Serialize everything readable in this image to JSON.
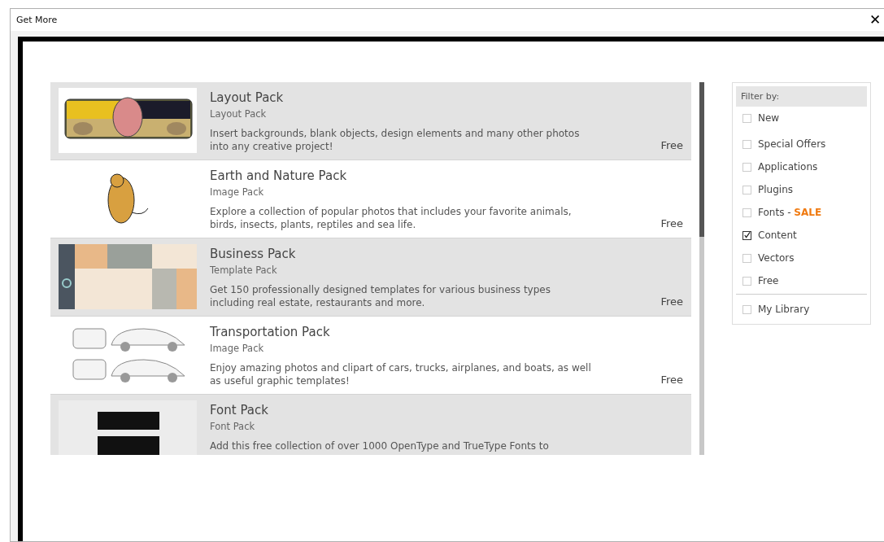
{
  "window": {
    "title": "Get More",
    "close": "✕"
  },
  "products": [
    {
      "title": "Layout Pack",
      "type": "Layout Pack",
      "description": "Insert backgrounds, blank objects, design elements and many other photos into any creative project!",
      "price": "Free",
      "kind": "layout"
    },
    {
      "title": "Earth and Nature Pack",
      "type": "Image Pack",
      "description": "Explore a collection of popular photos that includes your favorite animals, birds, insects, plants, reptiles and sea life.",
      "price": "Free",
      "kind": "nature"
    },
    {
      "title": "Business Pack",
      "type": "Template Pack",
      "description": "Get 150 professionally designed templates for various business types including real estate, restaurants and more.",
      "price": "Free",
      "kind": "business"
    },
    {
      "title": "Transportation Pack",
      "type": "Image Pack",
      "description": "Enjoy amazing photos and clipart of cars, trucks, airplanes, and boats, as well as useful graphic templates!",
      "price": "Free",
      "kind": "cars"
    },
    {
      "title": "Font Pack",
      "type": "Font Pack",
      "description": "Add this free collection of over 1000 OpenType and TrueType Fonts to",
      "kind": "fonts"
    }
  ],
  "filter": {
    "heading": "Filter by:",
    "options": [
      {
        "label": "New",
        "checked": false
      },
      {
        "label": "Special Offers",
        "checked": false
      },
      {
        "label": "Applications",
        "checked": false
      },
      {
        "label": "Plugins",
        "checked": false
      },
      {
        "label": "Fonts - **SALE**",
        "checked": false
      },
      {
        "label": "Content",
        "checked": true
      },
      {
        "label": "Vectors",
        "checked": false
      },
      {
        "label": "Free",
        "checked": false
      }
    ],
    "library": [
      {
        "label": "My Library",
        "checked": false
      }
    ]
  }
}
